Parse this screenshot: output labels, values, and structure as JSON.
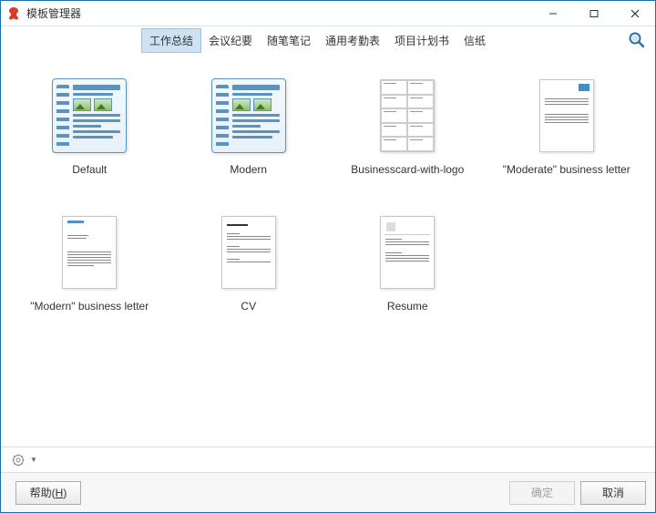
{
  "window": {
    "title": "模板管理器"
  },
  "tabs": [
    {
      "label": "工作总结",
      "active": true
    },
    {
      "label": "会议纪要",
      "active": false
    },
    {
      "label": "随笔笔记",
      "active": false
    },
    {
      "label": "通用考勤表",
      "active": false
    },
    {
      "label": "项目计划书",
      "active": false
    },
    {
      "label": "信纸",
      "active": false
    }
  ],
  "templates": [
    {
      "label": "Default",
      "kind": "notebook"
    },
    {
      "label": "Modern",
      "kind": "notebook"
    },
    {
      "label": "Businesscard-with-logo",
      "kind": "card"
    },
    {
      "label": "\"Moderate\" business letter",
      "kind": "letter-blue"
    },
    {
      "label": "\"Modern\" business letter",
      "kind": "letter-plain"
    },
    {
      "label": "CV",
      "kind": "cv"
    },
    {
      "label": "Resume",
      "kind": "resume"
    }
  ],
  "buttons": {
    "help": "帮助(H)",
    "ok": "确定",
    "cancel": "取消"
  }
}
